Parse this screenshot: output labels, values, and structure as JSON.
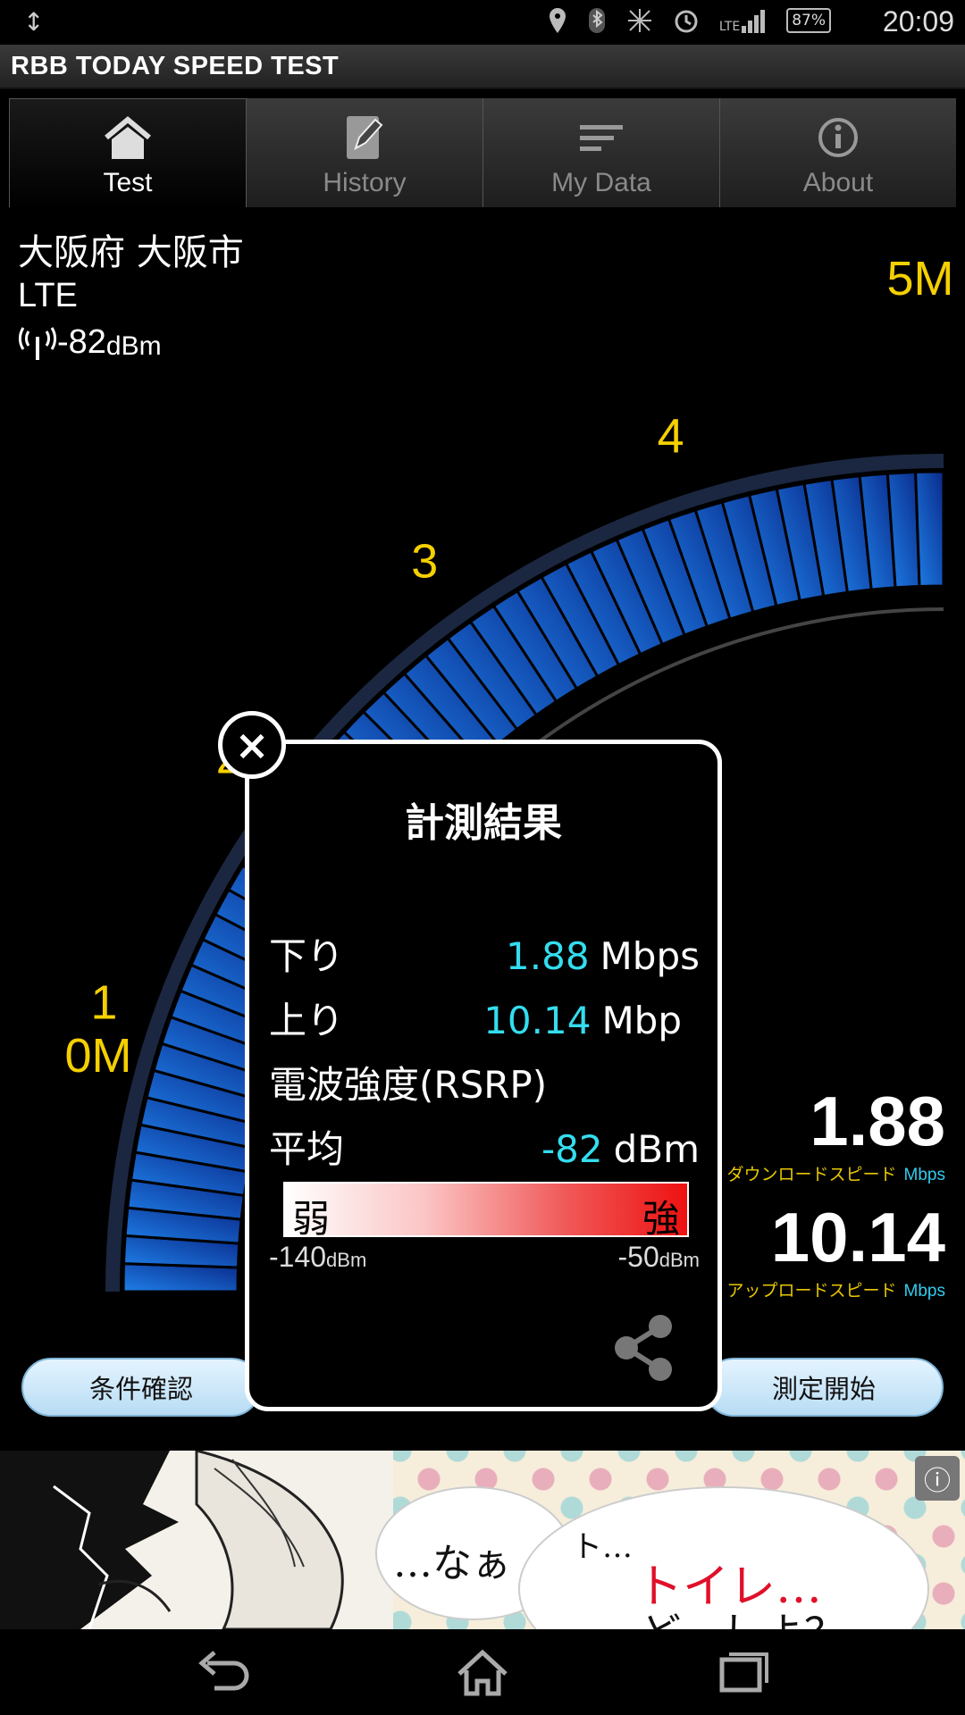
{
  "status_bar": {
    "usb_icon": "up-down-arrow-icon",
    "icons": [
      "location-icon",
      "bluetooth-icon",
      "vibrate-icon",
      "alarm-icon",
      "signal-icon"
    ],
    "lte": "LTE",
    "battery": "87%",
    "time": "20:09"
  },
  "app_title": "RBB TODAY SPEED TEST",
  "tabs": [
    {
      "label": "Test",
      "icon": "home-icon",
      "active": true
    },
    {
      "label": "History",
      "icon": "edit-icon",
      "active": false
    },
    {
      "label": "My Data",
      "icon": "list-icon",
      "active": false
    },
    {
      "label": "About",
      "icon": "info-icon",
      "active": false
    }
  ],
  "location": "大阪府 大阪市",
  "network": "LTE",
  "signal": {
    "value": "-82",
    "unit": "dBm"
  },
  "gauge": {
    "labels": [
      "0M",
      "1",
      "2",
      "3",
      "4",
      "5M"
    ],
    "bar_color": "#1e7fe8"
  },
  "readouts": {
    "download": {
      "value": "1.88",
      "caption": "ダウンロードスピード",
      "unit": "Mbps"
    },
    "upload": {
      "value": "10.14",
      "caption": "アップロードスピード",
      "unit": "Mbps"
    }
  },
  "buttons": {
    "conditions": "条件確認",
    "start": "測定開始"
  },
  "dialog": {
    "title": "計測結果",
    "down_label": "下り",
    "down_value": "1.88",
    "down_unit": "Mbps",
    "up_label": "上り",
    "up_value": "10.14",
    "up_unit": "Mbp",
    "rsrp_label": "電波強度(RSRP)",
    "avg_label": "平均",
    "avg_value": "-82",
    "avg_unit": "dBm",
    "weak": "弱",
    "strong": "強",
    "scale_min": "-140",
    "scale_max": "-50",
    "scale_unit": "dBm",
    "close": "×"
  },
  "ad": {
    "text1": "…なぁ",
    "text2": "ト…",
    "text3": "トイレ…",
    "text4": "どーしよ？",
    "info_icon": "info-icon"
  },
  "nav": [
    "back-icon",
    "home-icon",
    "recents-icon"
  ]
}
